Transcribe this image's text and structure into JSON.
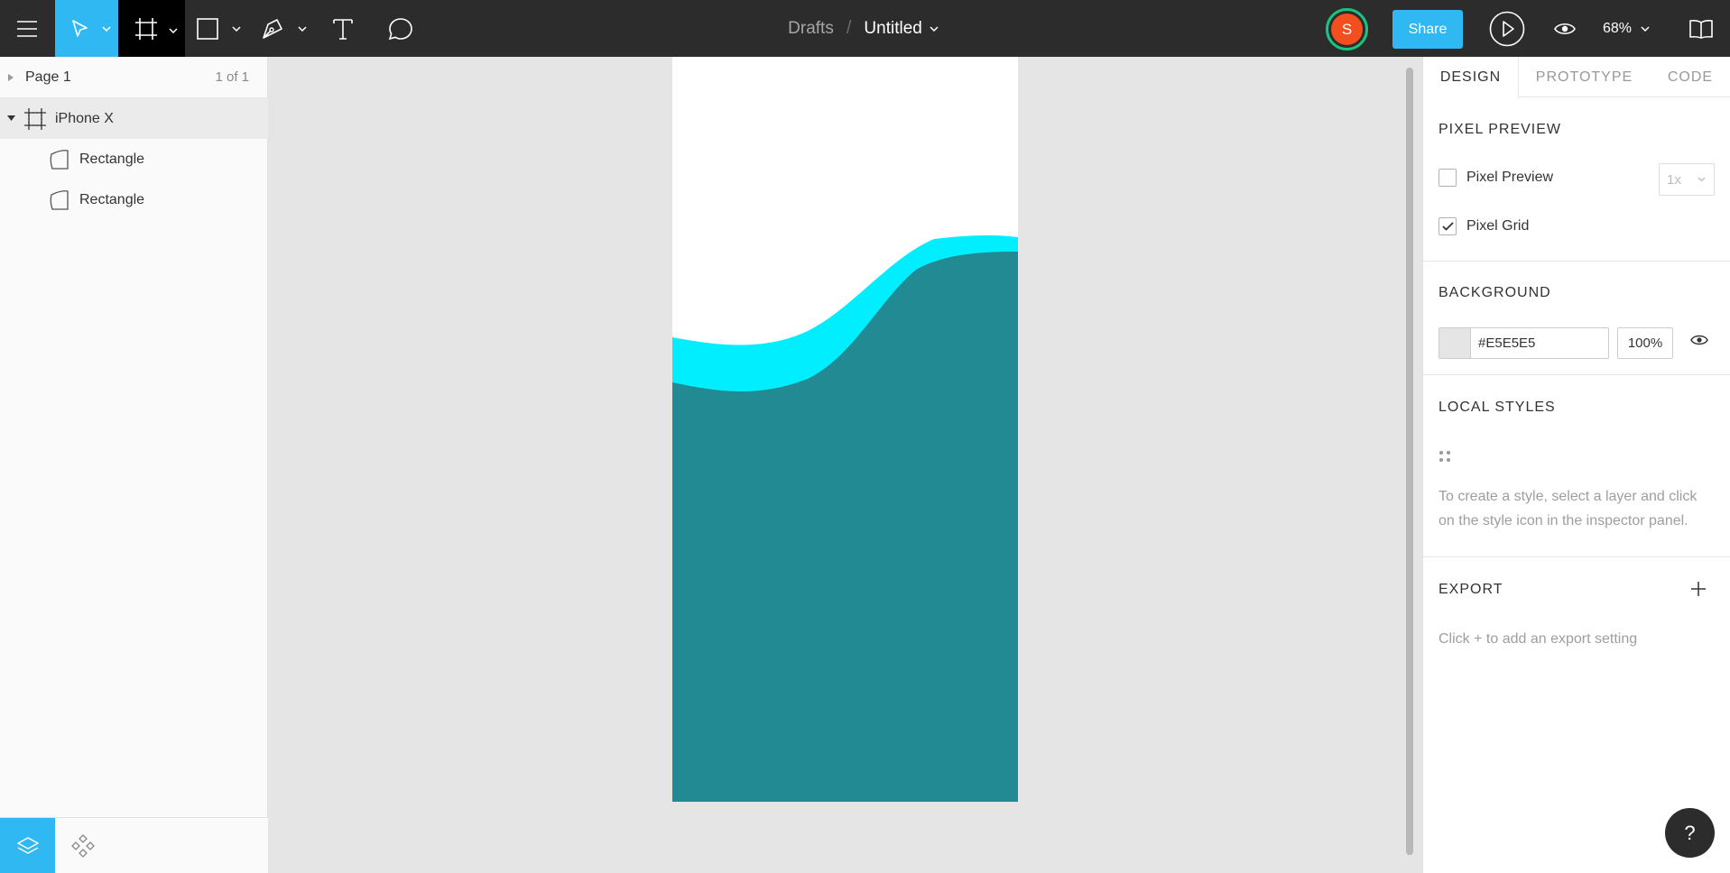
{
  "toolbar": {
    "breadcrumb_root": "Drafts",
    "breadcrumb_separator": "/",
    "file_title": "Untitled",
    "avatar_initial": "S",
    "share_label": "Share",
    "zoom_level": "68%",
    "icons": [
      "menu-icon",
      "move-tool-icon",
      "frame-tool-icon",
      "rectangle-tool-icon",
      "pen-tool-icon",
      "text-tool-icon",
      "comment-tool-icon",
      "present-icon",
      "view-icon",
      "library-icon"
    ]
  },
  "left_panel": {
    "page_name": "Page 1",
    "page_count": "1 of 1",
    "layers": [
      {
        "name": "iPhone X",
        "type": "frame",
        "expanded": true
      },
      {
        "name": "Rectangle",
        "type": "vector"
      },
      {
        "name": "Rectangle",
        "type": "vector"
      }
    ]
  },
  "canvas": {
    "background": "#E5E5E5",
    "artboard_background": "#FFFFFF",
    "wave_light_color": "#00EEFF",
    "wave_dark_color": "#218A92"
  },
  "right_panel": {
    "tabs": [
      "DESIGN",
      "PROTOTYPE",
      "CODE"
    ],
    "active_tab": "DESIGN",
    "pixel_preview": {
      "title": "PIXEL PREVIEW",
      "pixel_preview_label": "Pixel Preview",
      "pixel_preview_checked": false,
      "scale_value": "1x",
      "pixel_grid_label": "Pixel Grid",
      "pixel_grid_checked": true
    },
    "background": {
      "title": "BACKGROUND",
      "hex": "#E5E5E5",
      "opacity": "100%"
    },
    "local_styles": {
      "title": "LOCAL STYLES",
      "help_line_1": "To create a style, select a layer and click",
      "help_line_2": "on the style icon in the inspector panel."
    },
    "export": {
      "title": "EXPORT",
      "help": "Click + to add an export setting"
    }
  },
  "help_button": "?"
}
